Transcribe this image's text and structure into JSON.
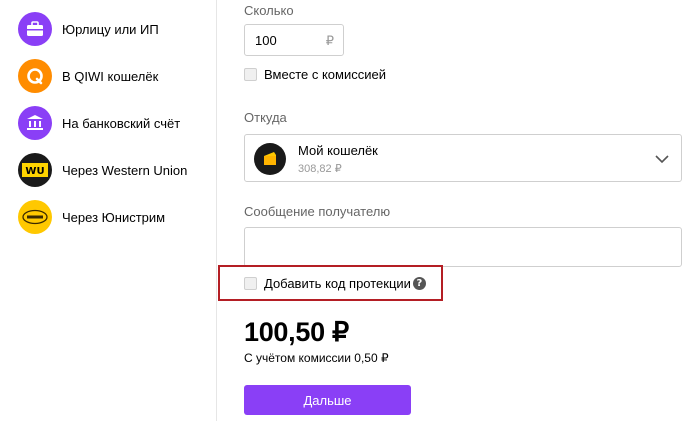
{
  "sidebar": {
    "items": [
      {
        "label": "Юрлицу или ИП",
        "icon": "briefcase-icon"
      },
      {
        "label": "В QIWI кошелёк",
        "icon": "qiwi-logo-icon"
      },
      {
        "label": "На банковский счёт",
        "icon": "bank-icon"
      },
      {
        "label": "Через Western Union",
        "icon": "western-union-logo-icon",
        "icon_text": "WU"
      },
      {
        "label": "Через Юнистрим",
        "icon": "unistream-logo-icon"
      }
    ]
  },
  "form": {
    "amount_label": "Сколько",
    "amount_value": "100",
    "amount_currency": "₽",
    "commission_checkbox_label": "Вместе с комиссией",
    "source_label": "Откуда",
    "wallet_name": "Мой кошелёк",
    "wallet_balance": "308,82 ₽",
    "message_label": "Сообщение получателю",
    "message_value": "",
    "protection_checkbox_label": "Добавить код протекции",
    "help_glyph": "?",
    "total": "100,50 ₽",
    "commission_note": "С учётом комиссии 0,50 ₽",
    "next_button_label": "Дальше"
  },
  "colors": {
    "accent": "#8a3ff6",
    "qiwi_orange": "#ff8c00",
    "highlight_red": "#b41e24"
  }
}
